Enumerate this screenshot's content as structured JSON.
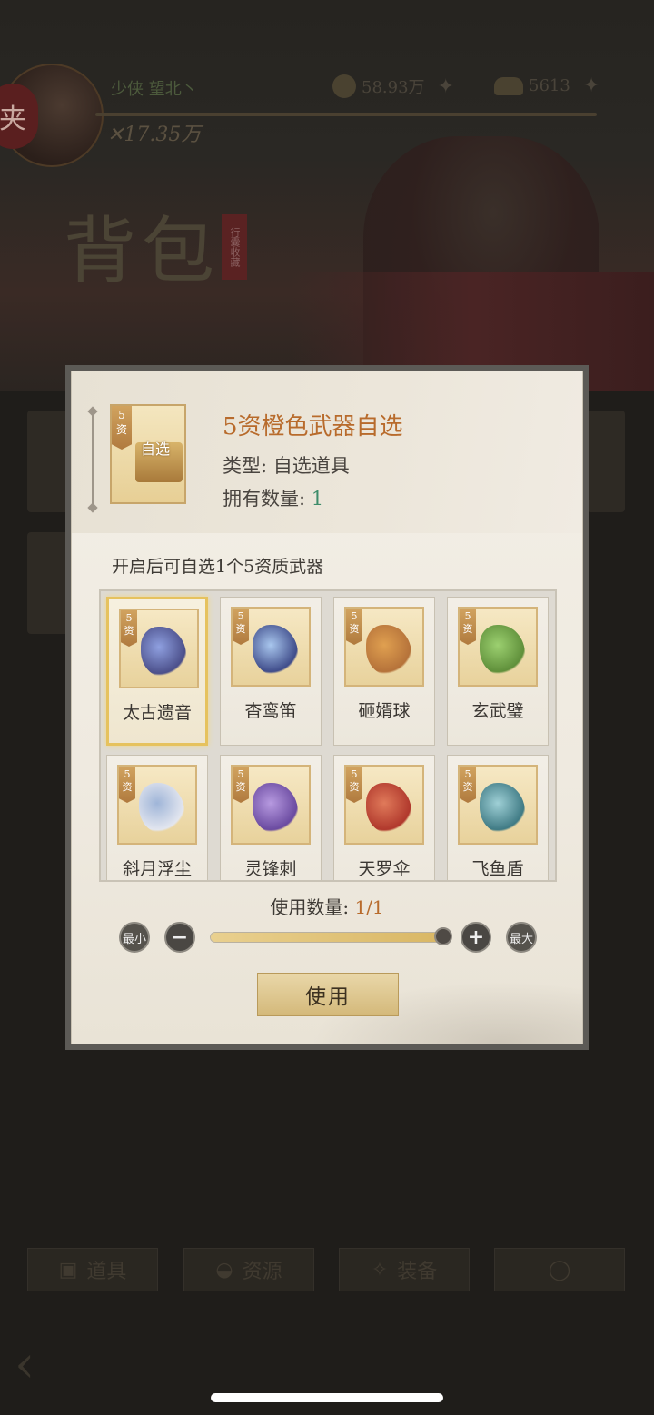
{
  "background": {
    "player_name": "少侠 望北丶",
    "power": "✕17.35万",
    "currency_1": "58.93万",
    "currency_2": "5613",
    "seal_char": "夹",
    "bag_title": "背包",
    "bag_seal_text": "行囊收藏",
    "tabs": [
      {
        "label": "道具",
        "icon": "box-icon"
      },
      {
        "label": "资源",
        "icon": "pot-icon"
      },
      {
        "label": "装备",
        "icon": "gear-icon"
      },
      {
        "label": "",
        "icon": "circle-icon"
      }
    ]
  },
  "modal": {
    "item": {
      "grade": "5\n资",
      "badge_text": "自选",
      "title": "5资橙色武器自选",
      "type_label": "类型: ",
      "type_value": "自选道具",
      "owned_label": "拥有数量: ",
      "owned_value": "1"
    },
    "description": "开启后可自选1个5资质武器",
    "weapons": [
      {
        "name": "太古遗音",
        "grade": "5\n资",
        "selected": true,
        "colors": [
          "#4b4f8a",
          "#8fa0e0"
        ]
      },
      {
        "name": "杳鸾笛",
        "grade": "5\n资",
        "selected": false,
        "colors": [
          "#3f4c8a",
          "#a9c7ee"
        ]
      },
      {
        "name": "砸婿球",
        "grade": "5\n资",
        "selected": false,
        "colors": [
          "#b5723a",
          "#e0a050"
        ]
      },
      {
        "name": "玄武璧",
        "grade": "5\n资",
        "selected": false,
        "colors": [
          "#5f8f3a",
          "#9cd070"
        ]
      },
      {
        "name": "斜月浮尘",
        "grade": "5\n资",
        "selected": false,
        "colors": [
          "#e3e6ef",
          "#9fb5d8"
        ]
      },
      {
        "name": "灵锋刺",
        "grade": "5\n资",
        "selected": false,
        "colors": [
          "#6a4aa0",
          "#b79ae0"
        ]
      },
      {
        "name": "天罗伞",
        "grade": "5\n资",
        "selected": false,
        "colors": [
          "#b0382c",
          "#e07a5a"
        ]
      },
      {
        "name": "飞鱼盾",
        "grade": "5\n资",
        "selected": false,
        "colors": [
          "#3f7a84",
          "#9fd0d6"
        ]
      }
    ],
    "usage_label": "使用数量: ",
    "usage_value": "1/1",
    "slider_fraction": 1.0,
    "min_label": "最小",
    "max_label": "最大",
    "minus_symbol": "−",
    "plus_symbol": "+",
    "use_button": "使用"
  }
}
